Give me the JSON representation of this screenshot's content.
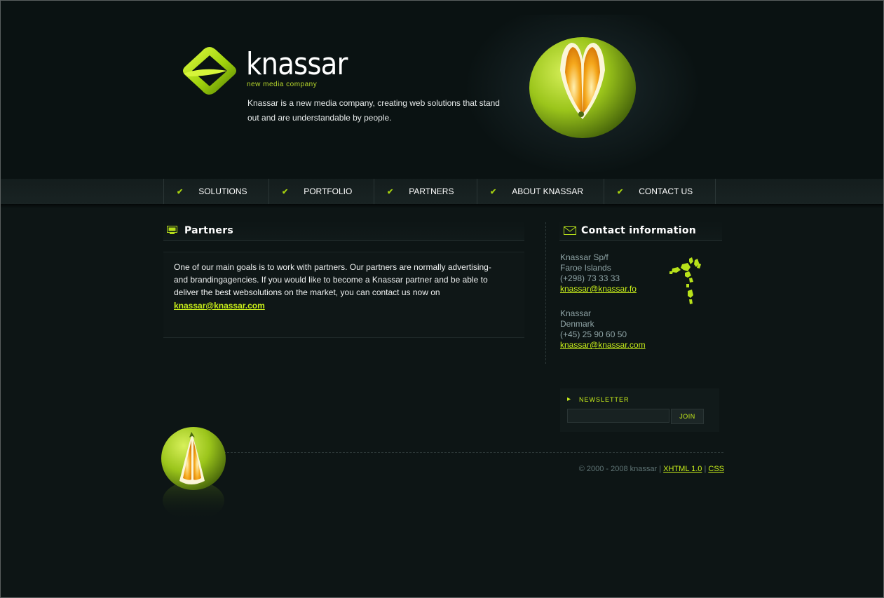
{
  "brand": {
    "name": "knassar",
    "tagline": "new media company",
    "intro": "Knassar is a new media company, creating web solutions that stand out and are understandable by people."
  },
  "nav": {
    "items": [
      {
        "label": "SOLUTIONS",
        "icon": "check-icon"
      },
      {
        "label": "PORTFOLIO",
        "icon": "check-icon"
      },
      {
        "label": "PARTNERS",
        "icon": "check-icon"
      },
      {
        "label": "ABOUT KNASSAR",
        "icon": "check-icon"
      },
      {
        "label": "CONTACT US",
        "icon": "check-icon"
      }
    ]
  },
  "partners": {
    "title": "Partners",
    "icon": "monitor-icon",
    "body": "One of our main goals is to work with partners. Our partners are normally advertising- and brandingagencies. If you would like to become a Knassar partner and be able to deliver the best websolutions on the market, you can contact us now on",
    "email": "knassar@knassar.com"
  },
  "contact": {
    "title": "Contact information",
    "icon": "envelope-icon",
    "offices": [
      {
        "name": "Knassar Sp/f",
        "location": "Faroe Islands",
        "phone": "(+298) 73 33 33",
        "email": "knassar@knassar.fo"
      },
      {
        "name": "Knassar",
        "location": "Denmark",
        "phone": "(+45) 25 90 60 50",
        "email": "knassar@knassar.com"
      }
    ]
  },
  "newsletter": {
    "label": "NEWSLETTER",
    "input_value": "",
    "join_label": "JOIN"
  },
  "footer": {
    "copyright": "© 2000 - 2008 knassar |",
    "separator": "|",
    "xhtml_link": "XHTML 1.0",
    "css_link": "CSS"
  },
  "colors": {
    "accent": "#c9ef1a",
    "background": "#0d1515",
    "text_muted": "#8fa4a6"
  }
}
